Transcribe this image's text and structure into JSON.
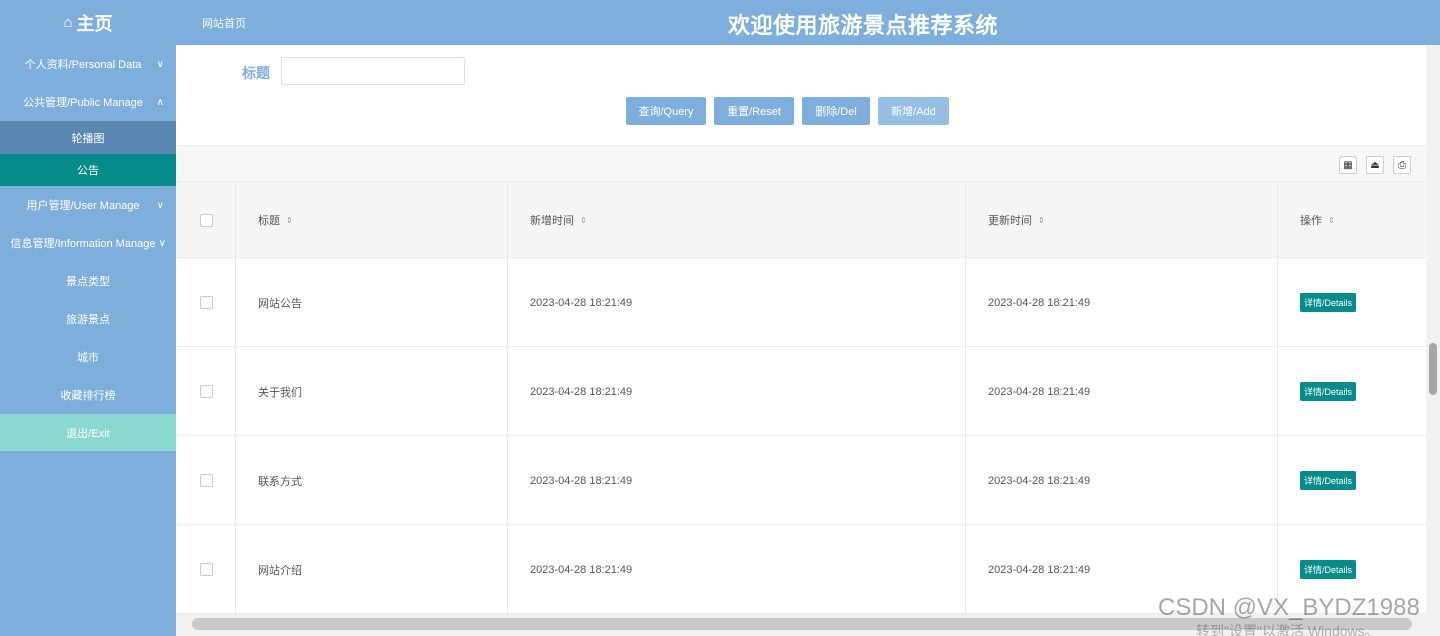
{
  "header": {
    "home_icon": "⌂",
    "home_label": "主页",
    "breadcrumb": "网站首页",
    "app_title": "欢迎使用旅游景点推荐系统"
  },
  "sidebar": {
    "items": [
      {
        "label": "个人资料/Personal Data",
        "chevron": "∨"
      },
      {
        "label": "公共管理/Public Manage",
        "chevron": "∧"
      },
      {
        "label": "轮播图"
      },
      {
        "label": "公告"
      },
      {
        "label": "用户管理/User Manage",
        "chevron": "∨"
      },
      {
        "label": "信息管理/Information Manage",
        "chevron": "∨"
      },
      {
        "label": "景点类型"
      },
      {
        "label": "旅游景点"
      },
      {
        "label": "城市"
      },
      {
        "label": "收藏排行榜"
      },
      {
        "label": "退出/Exit"
      }
    ]
  },
  "search": {
    "label": "标题",
    "value": ""
  },
  "buttons": {
    "query": "查询/Query",
    "reset": "重置/Reset",
    "del": "删除/Del",
    "add": "新增/Add"
  },
  "toolbar": {
    "icons": [
      "columns-icon",
      "export-icon",
      "print-icon"
    ],
    "glyphs": [
      "▦",
      "⏏",
      "⎙"
    ]
  },
  "table": {
    "columns": [
      "标题",
      "新增时间",
      "更新时间",
      "操作"
    ],
    "sort_glyph": "⇕",
    "rows": [
      {
        "title": "网站公告",
        "created": "2023-04-28 18:21:49",
        "updated": "2023-04-28 18:21:49",
        "action": "详情/Details"
      },
      {
        "title": "关于我们",
        "created": "2023-04-28 18:21:49",
        "updated": "2023-04-28 18:21:49",
        "action": "详情/Details"
      },
      {
        "title": "联系方式",
        "created": "2023-04-28 18:21:49",
        "updated": "2023-04-28 18:21:49",
        "action": "详情/Details"
      },
      {
        "title": "网站介绍",
        "created": "2023-04-28 18:21:49",
        "updated": "2023-04-28 18:21:49",
        "action": "详情/Details"
      }
    ]
  },
  "watermark": {
    "line1": "CSDN @VX_BYDZ1988",
    "line2": "转到\"设置\"以激活 Windows。"
  },
  "colors": {
    "primary": "#7eaedc",
    "teal": "#068b8b",
    "exit": "#8ad8cf"
  }
}
